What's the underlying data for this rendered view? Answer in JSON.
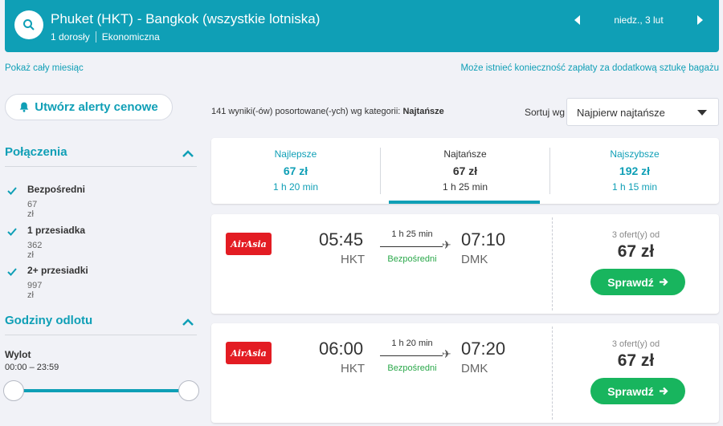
{
  "header": {
    "route": "Phuket (HKT) - Bangkok (wszystkie lotniska)",
    "passengers": "1 dorosły",
    "cabin": "Ekonomiczna",
    "date": "niedz., 3 lut"
  },
  "links": {
    "month": "Pokaż cały miesiąc",
    "baggage": "Może istnieć konieczność zapłaty za dodatkową sztukę bagażu"
  },
  "sidebar": {
    "alert_button": "Utwórz alerty cenowe",
    "connections_title": "Połączenia",
    "filters": [
      {
        "label": "Bezpośredni",
        "price": "67 zł",
        "checked": true
      },
      {
        "label": "1 przesiadka",
        "price": "362 zł",
        "checked": true
      },
      {
        "label": "2+ przesiadki",
        "price": "997 zł",
        "checked": true
      }
    ],
    "departure_title": "Godziny odlotu",
    "departure_label": "Wylot",
    "departure_range": "00:00 – 23:59"
  },
  "results": {
    "count_text": "141 wyniki(-ów) posortowane(-ych) wg kategorii:",
    "sort_category": "Najtańsze",
    "sort_label": "Sortuj wg",
    "sort_value": "Najpierw najtańsze"
  },
  "tabs": [
    {
      "label": "Najlepsze",
      "price": "67 zł",
      "duration": "1 h 20 min"
    },
    {
      "label": "Najtańsze",
      "price": "67 zł",
      "duration": "1 h 25 min"
    },
    {
      "label": "Najszybsze",
      "price": "192 zł",
      "duration": "1 h 15 min"
    }
  ],
  "flights": [
    {
      "airline": "AirAsia",
      "dep_time": "05:45",
      "dep_code": "HKT",
      "duration": "1 h 25 min",
      "stops": "Bezpośredni",
      "arr_time": "07:10",
      "arr_code": "DMK",
      "offers": "3 ofert(y) od",
      "price": "67 zł",
      "button": "Sprawdź"
    },
    {
      "airline": "AirAsia",
      "dep_time": "06:00",
      "dep_code": "HKT",
      "duration": "1 h 20 min",
      "stops": "Bezpośredni",
      "arr_time": "07:20",
      "arr_code": "DMK",
      "offers": "3 ofert(y) od",
      "price": "67 zł",
      "button": "Sprawdź"
    }
  ],
  "colors": {
    "accent": "#0f9fb6",
    "cta": "#18b55e",
    "airline": "#e31c23",
    "direct": "#2aa84a"
  },
  "icons": [
    "search-icon",
    "chevron-left-icon",
    "chevron-right-icon",
    "bell-icon",
    "chevron-up-icon",
    "check-icon",
    "caret-down-icon",
    "plane-icon",
    "arrow-right-icon"
  ]
}
